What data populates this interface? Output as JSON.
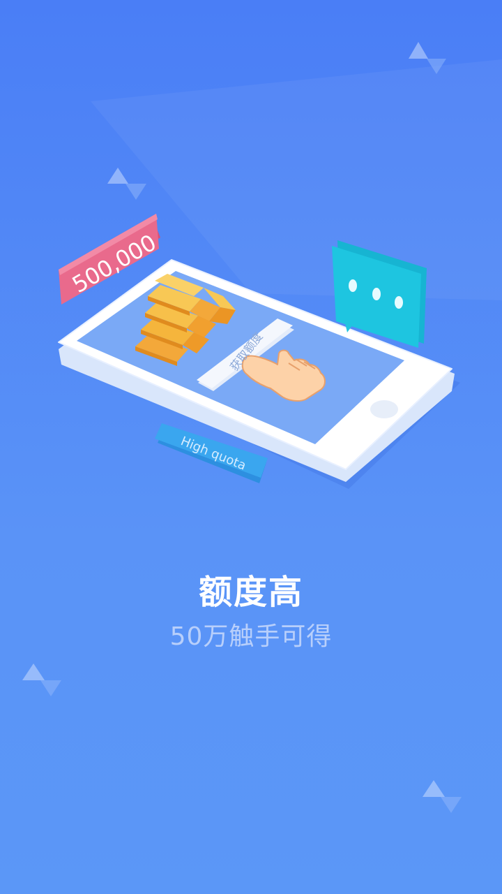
{
  "illustration": {
    "amount_badge": "500,000",
    "phone_button": "获取额度",
    "tag_label": "High quota"
  },
  "onboarding": {
    "title": "额度高",
    "subtitle": "50万触手可得"
  },
  "colors": {
    "background_top": "#4a7ef6",
    "background_bottom": "#5b97f7",
    "badge": "#e96a8c",
    "chat": "#1ec5e0",
    "gold": "#f5b53c"
  }
}
